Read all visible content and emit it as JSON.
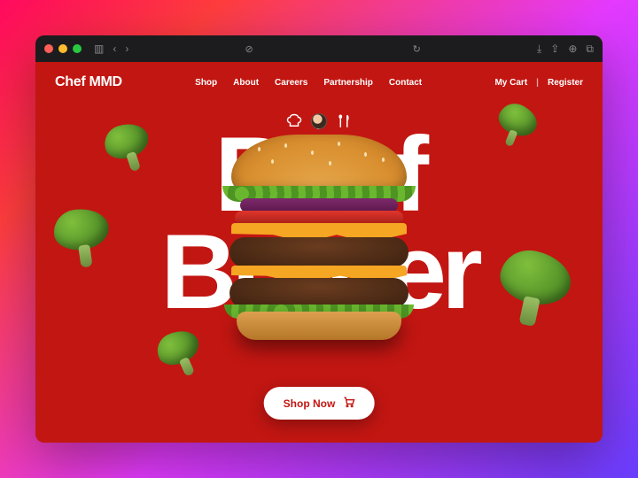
{
  "logo": "Chef MMD",
  "nav": {
    "items": [
      "Shop",
      "About",
      "Careers",
      "Partnership",
      "Contact"
    ],
    "my_cart": "My Cart",
    "register": "Register"
  },
  "hero": {
    "line1": "Beef",
    "line2": "Burger"
  },
  "cta": {
    "label": "Shop Now"
  },
  "icons": {
    "chef_hat": "chef-hat-icon",
    "avatar": "avatar-icon",
    "utensils": "utensils-icon",
    "cart": "cart-icon"
  }
}
